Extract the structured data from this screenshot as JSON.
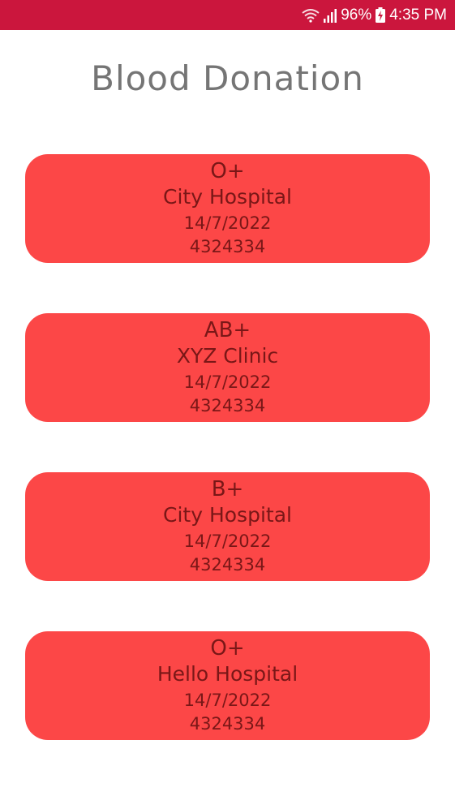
{
  "status_bar": {
    "battery": "96%",
    "time": "4:35 PM",
    "icons": [
      "wifi-icon",
      "signal-icon",
      "battery-charging-icon"
    ],
    "color": "#cb163d"
  },
  "title": "Blood Donation",
  "accent_color": "#fc4747",
  "donations": [
    {
      "blood_type": "O+",
      "location": "City Hospital",
      "date": "14/7/2022",
      "phone": "4324334"
    },
    {
      "blood_type": "AB+",
      "location": "XYZ Clinic",
      "date": "14/7/2022",
      "phone": "4324334"
    },
    {
      "blood_type": "B+",
      "location": "City Hospital",
      "date": "14/7/2022",
      "phone": "4324334"
    },
    {
      "blood_type": "O+",
      "location": "Hello Hospital",
      "date": "14/7/2022",
      "phone": "4324334"
    }
  ]
}
